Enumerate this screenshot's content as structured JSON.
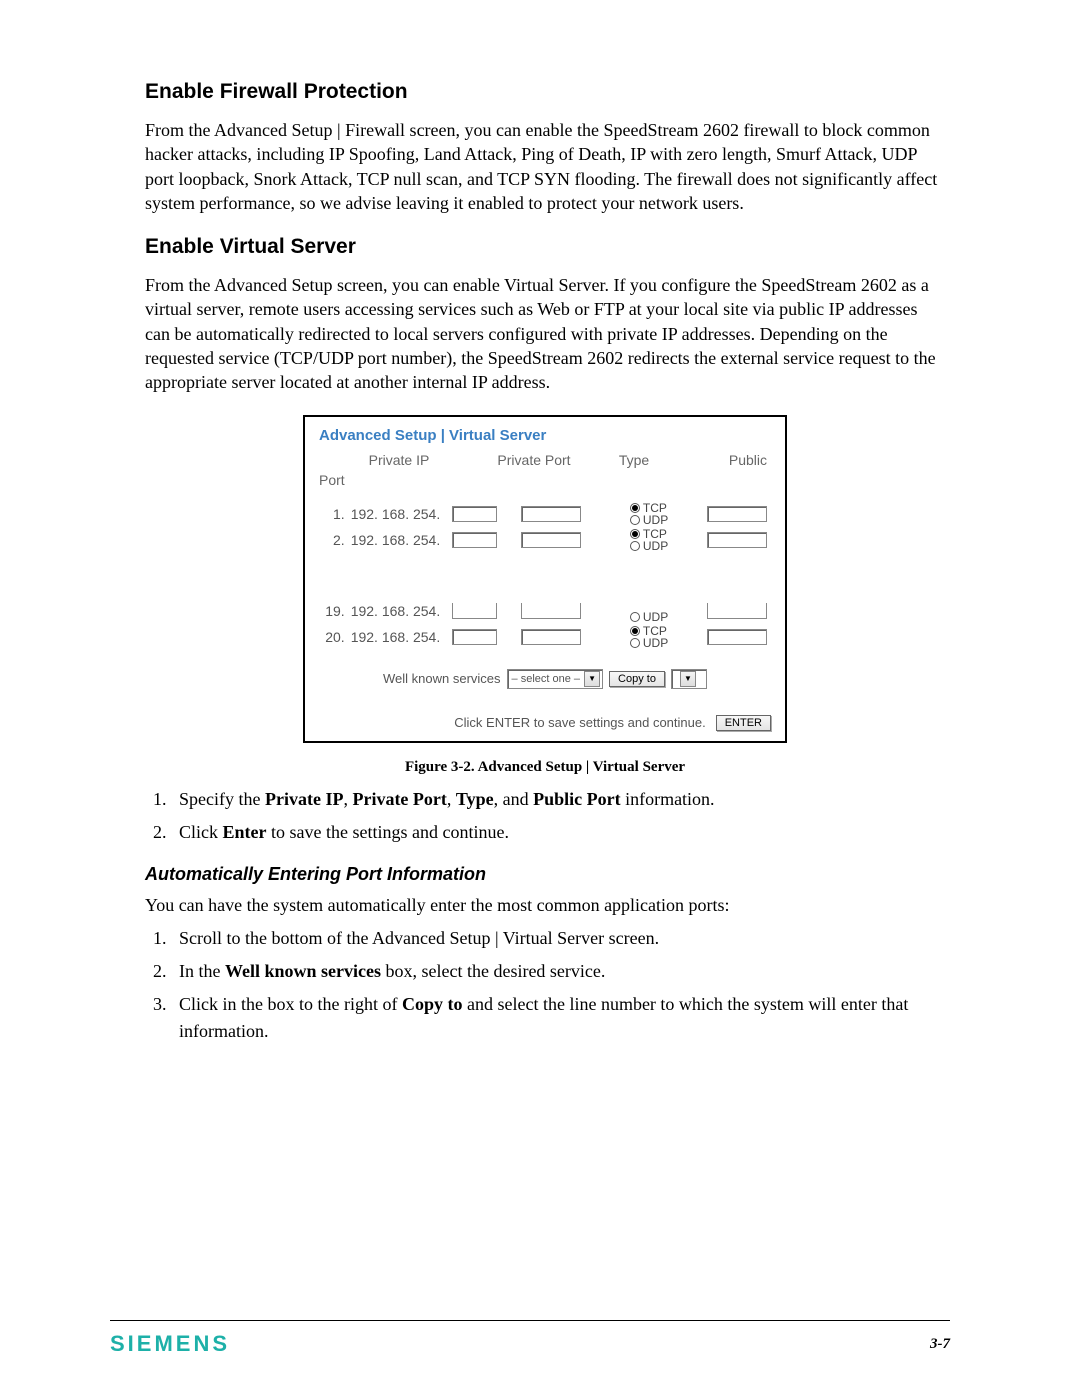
{
  "section1": {
    "title": "Enable Firewall Protection",
    "para": "From the Advanced Setup | Firewall screen, you can enable the SpeedStream 2602 firewall to block common hacker attacks, including IP Spoofing, Land Attack, Ping of Death, IP with zero length, Smurf Attack, UDP port loopback, Snork Attack, TCP null scan, and TCP SYN flooding. The firewall does not significantly affect system performance, so we advise leaving it enabled to protect your network users."
  },
  "section2": {
    "title": "Enable Virtual Server",
    "para": "From the Advanced Setup screen, you can enable Virtual Server. If you configure the SpeedStream 2602 as a virtual server, remote users accessing services such as Web or FTP at your local site via public IP addresses can be automatically redirected to local servers configured with private IP addresses. Depending on the requested service (TCP/UDP port number), the SpeedStream 2602 redirects the external service request to the appropriate server located at another internal IP address."
  },
  "figure": {
    "panel_title": "Advanced Setup | Virtual Server",
    "headers": {
      "private_ip": "Private IP",
      "private_port": "Private Port",
      "type": "Type",
      "public": "Public",
      "port": "Port"
    },
    "ip_prefix": "192. 168. 254.",
    "rows_top": [
      {
        "num": "1.",
        "tcp": true,
        "udp": false
      },
      {
        "num": "2.",
        "tcp": true,
        "udp": false
      }
    ],
    "rows_bottom": [
      {
        "num": "19.",
        "tcp": false,
        "udp": false,
        "partial_top": true
      },
      {
        "num": "20.",
        "tcp": true,
        "udp": false
      }
    ],
    "type_labels": {
      "tcp": "TCP",
      "udp": "UDP"
    },
    "wks_label": "Well known services",
    "wks_select": "– select one –",
    "copy_to": "Copy to",
    "enter_hint": "Click ENTER to save settings and continue.",
    "enter_btn": "ENTER",
    "caption": "Figure 3-2.  Advanced Setup | Virtual Server"
  },
  "steps1": {
    "item1_pre": "Specify the ",
    "b1": "Private IP",
    "c1": ", ",
    "b2": "Private Port",
    "c2": ", ",
    "b3": "Type",
    "c3": ", and ",
    "b4": "Public Port",
    "item1_post": " information.",
    "item2_pre": "Click ",
    "b5": "Enter",
    "item2_post": " to save the settings and continue."
  },
  "section3": {
    "title": "Automatically Entering Port Information",
    "para": "You can have the system automatically enter the most common application ports:"
  },
  "steps2": {
    "item1": "Scroll to the bottom of the Advanced Setup | Virtual Server screen.",
    "item2_pre": "In the ",
    "b1": "Well known services",
    "item2_post": " box, select the desired service.",
    "item3_pre": "Click in the box to the right of ",
    "b2": "Copy to",
    "item3_post": " and select the line number to which the system will enter that information."
  },
  "footer": {
    "brand": "SIEMENS",
    "page": "3-7"
  }
}
